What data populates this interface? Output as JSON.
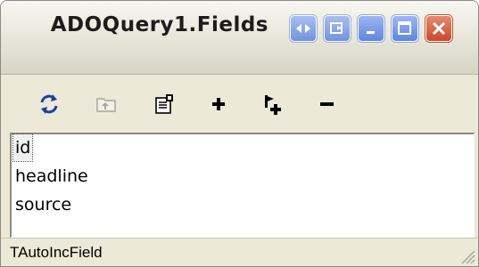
{
  "window": {
    "title": "ADOQuery1.Fields"
  },
  "titlebar": {
    "buttons": [
      {
        "icon": "scroll-arrows-icon"
      },
      {
        "icon": "restore-window-icon"
      },
      {
        "icon": "minimize-icon"
      },
      {
        "icon": "maximize-icon"
      },
      {
        "icon": "close-icon"
      }
    ]
  },
  "toolbar": {
    "items": [
      {
        "icon": "refresh-icon"
      },
      {
        "icon": "up-one-level-icon"
      },
      {
        "icon": "properties-icon"
      },
      {
        "icon": "add-icon"
      },
      {
        "icon": "add-field-icon"
      },
      {
        "icon": "remove-icon"
      }
    ]
  },
  "fields": {
    "items": [
      {
        "label": "id",
        "selected": true
      },
      {
        "label": "headline",
        "selected": false
      },
      {
        "label": "source",
        "selected": false
      }
    ]
  },
  "status": {
    "text": "TAutoIncField"
  },
  "colors": {
    "title_button_blue": "#5f86dc",
    "close_button_red": "#c94a2a",
    "frame": "#ece9d8"
  }
}
